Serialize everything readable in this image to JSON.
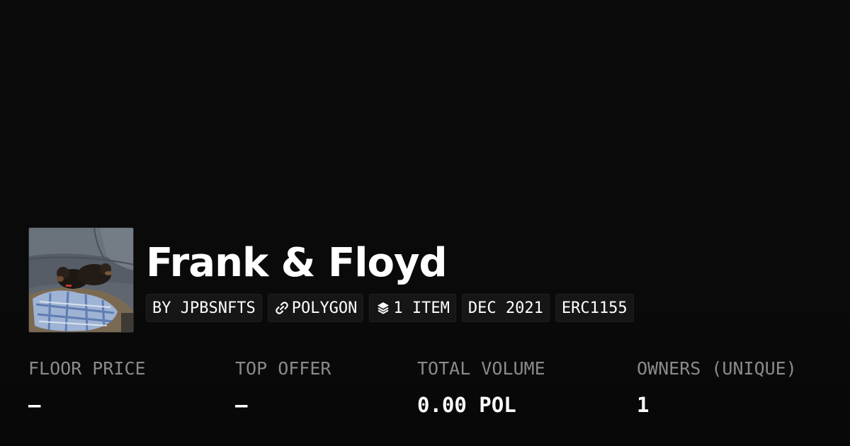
{
  "collection": {
    "title": "Frank & Floyd",
    "avatar_alt": "avatar-photo"
  },
  "pills": {
    "creator": "BY JPBSNFTS",
    "chain": "POLYGON",
    "chain_icon": "link-icon",
    "items": "1 ITEM",
    "items_icon": "layers-icon",
    "date": "DEC 2021",
    "standard": "ERC1155"
  },
  "stats": {
    "floor_price": {
      "label": "FLOOR PRICE",
      "value": "–"
    },
    "top_offer": {
      "label": "TOP OFFER",
      "value": "–"
    },
    "total_volume": {
      "label": "TOTAL VOLUME",
      "value": "0.00 POL"
    },
    "owners": {
      "label": "OWNERS (UNIQUE)",
      "value": "1"
    }
  },
  "colors": {
    "background": "#0a0a0a",
    "pill_bg": "#161616",
    "label": "#8a8a8a",
    "text": "#ffffff"
  }
}
